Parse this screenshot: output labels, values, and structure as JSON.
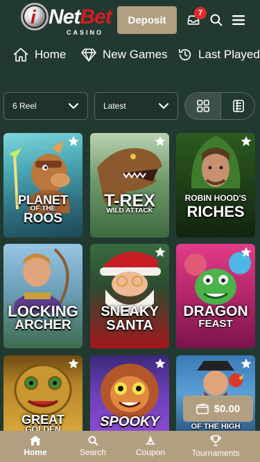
{
  "header": {
    "logo_prefix": "i",
    "logo_net": "Net",
    "logo_bet": "Bet",
    "logo_sub": "CASINO",
    "deposit_label": "Deposit",
    "notification_count": "7"
  },
  "nav": [
    {
      "label": "Home",
      "icon": "home-icon"
    },
    {
      "label": "New Games",
      "icon": "diamond-icon"
    },
    {
      "label": "Last Played",
      "icon": "history-icon"
    }
  ],
  "filters": {
    "reel_value": "6 Reel",
    "sort_value": "Latest"
  },
  "games": [
    {
      "title_top": "PLANET",
      "title_mid": "OF THE",
      "title_bottom": "ROOS"
    },
    {
      "title_top": "T-REX",
      "title_bottom": "WILD ATTACK"
    },
    {
      "title_top": "ROBIN HOOD'S",
      "title_bottom": "RICHES"
    },
    {
      "title_top": "LOCKING",
      "title_bottom": "ARCHER"
    },
    {
      "title_top": "SNEAKY",
      "title_bottom": "SANTA"
    },
    {
      "title_top": "DRAGON",
      "title_bottom": "FEAST"
    },
    {
      "title_top": "GREAT",
      "title_bottom": "GOLDEN"
    },
    {
      "title_top": "SPOOKY"
    },
    {
      "title_top": "OF THE HIGH"
    }
  ],
  "balance": "$0.00",
  "bottom_nav": [
    {
      "label": "Home",
      "icon": "home-icon",
      "active": true
    },
    {
      "label": "Search",
      "icon": "search-icon"
    },
    {
      "label": "Coupon",
      "icon": "coupon-icon"
    },
    {
      "label": "Tournaments",
      "icon": "trophy-icon"
    }
  ],
  "colors": {
    "background": "#22392f",
    "accent": "#b19f82",
    "badge": "#e0292d",
    "border": "#5b6c63"
  }
}
